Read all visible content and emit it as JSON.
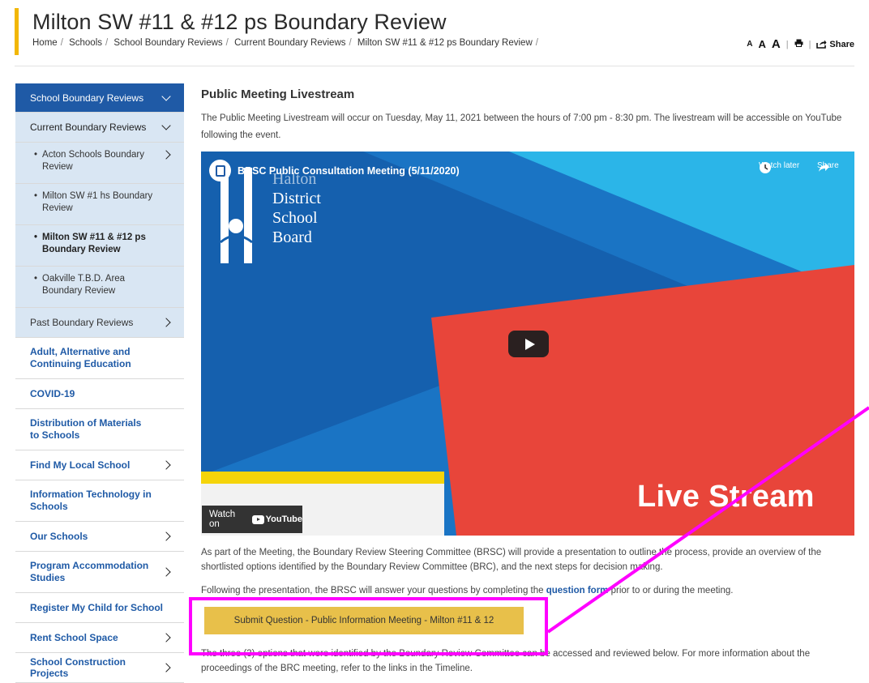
{
  "header": {
    "title": "Milton SW #11 & #12 ps Boundary Review",
    "breadcrumb": [
      "Home",
      "Schools",
      "School Boundary Reviews",
      "Current Boundary Reviews",
      "Milton SW #11 & #12 ps Boundary Review"
    ],
    "font_small": "A",
    "font_medium": "A",
    "font_large": "A",
    "share_label": "Share"
  },
  "sidebar": {
    "top": "School Boundary Reviews",
    "current": "Current Boundary Reviews",
    "current_items": [
      "Acton Schools Boundary Review",
      "Milton SW #1 hs Boundary Review",
      "Milton SW #11 & #12 ps Boundary Review",
      "Oakville T.B.D. Area Boundary Review"
    ],
    "past": "Past Boundary Reviews",
    "links": [
      "Adult, Alternative and Continuing Education",
      "COVID-19",
      "Distribution of Materials to Schools",
      "Find My Local School",
      "Information Technology in Schools",
      "Our Schools",
      "Program Accommodation Studies",
      "Register My Child for School",
      "Rent School Space",
      "School Construction Projects"
    ]
  },
  "main": {
    "section_title": "Public Meeting Livestream",
    "intro": "The Public Meeting Livestream will occur on Tuesday, May 11, 2021  between the hours of 7:00 pm - 8:30 pm. The livestream will be accessible on YouTube following the event.",
    "video": {
      "title": "BRSC Public Consultation Meeting (5/11/2020)",
      "watch_later": "Watch later",
      "share": "Share",
      "logo_lines": [
        "Halton",
        "District",
        "School",
        "Board"
      ],
      "overlay_text": "Live Stream",
      "watch_on": "Watch on",
      "youtube": "YouTube"
    },
    "para2": "As part of the Meeting, the Boundary Review Steering Committee (BRSC) will provide a presentation  to outline the process,  provide  an overview of the shortlisted options identified by the Boundary Review Committee (BRC), and the next steps for decision making.",
    "para3_before": "Following the presentation, the BRSC will answer your  questions by completing the ",
    "para3_link": "question form",
    "para3_after": " prior to or during the meeting.",
    "submit_button": "Submit Question - Public Information Meeting - Milton #11 & 12",
    "para4": "The three (3) options that were identified by the Boundary Review Committee can be accessed and reviewed below. For more information about the proceedings of the BRC meeting, refer to the links in the Timeline."
  },
  "colors": {
    "accent_yellow": "#f2b705",
    "nav_blue": "#1f5aa6",
    "sub_bg": "#d9e6f3",
    "button": "#e8c04a",
    "annotation": "#ff00ff"
  }
}
